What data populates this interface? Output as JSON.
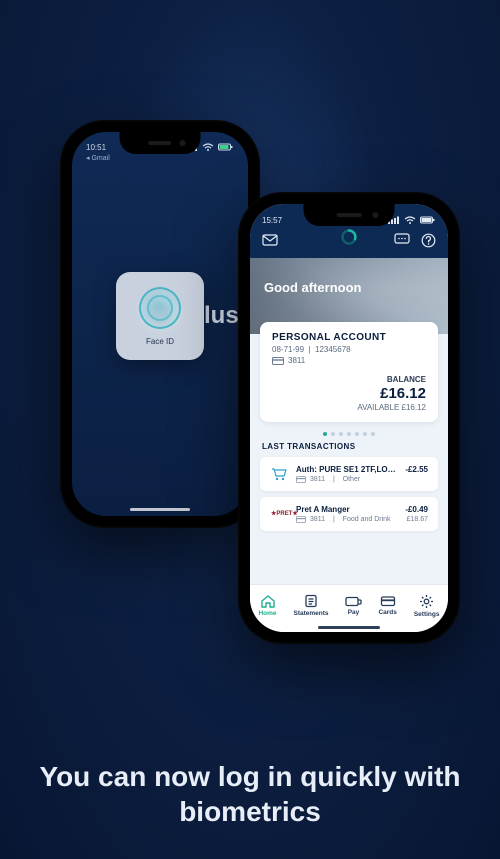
{
  "caption": "You can now log in quickly with biometrics",
  "brand_suffix": "lus",
  "phone_a": {
    "status_time": "10:51",
    "status_back": "Gmail",
    "faceid_label": "Face ID"
  },
  "phone_b": {
    "status_time": "15:57",
    "hero_greeting": "Good afternoon",
    "account": {
      "name": "PERSONAL ACCOUNT",
      "sortcode": "08-71-99",
      "number": "12345678",
      "card_mask": "3811",
      "balance_label": "BALANCE",
      "balance": "£16.12",
      "available_label": "AVAILABLE",
      "available": "£16.12"
    },
    "last_tx_heading": "LAST TRANSACTIONS",
    "transactions": [
      {
        "merchant": "Auth: PURE SE1 2TF,LONDON…",
        "amount": "-£2.55",
        "card": "3811",
        "category": "Other"
      },
      {
        "merchant": "Pret A Manger",
        "amount": "-£0.49",
        "card": "3811",
        "category": "Food and Drink",
        "amount_usd": "£18.67"
      }
    ],
    "nav": {
      "home": "Home",
      "statements": "Statements",
      "pay": "Pay",
      "cards": "Cards",
      "settings": "Settings"
    }
  }
}
